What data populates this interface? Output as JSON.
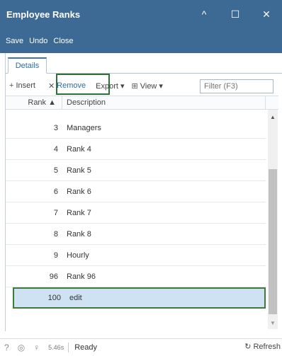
{
  "window": {
    "title": "Employee Ranks",
    "minimize": "^",
    "maximize": "☐",
    "close": "✕"
  },
  "menu": {
    "save": "Save",
    "undo": "Undo",
    "close": "Close"
  },
  "tabs": {
    "details": "Details"
  },
  "toolbar": {
    "insert": "Insert",
    "insert_icon": "+",
    "remove": "Remove",
    "remove_icon": "✕",
    "export": "Export ▾",
    "view": "View ▾",
    "view_icon": "⊞",
    "filter_placeholder": "Filter (F3)"
  },
  "grid": {
    "columns": {
      "rank": "Rank ▲",
      "description": "Description"
    },
    "rows": [
      {
        "rank": "3",
        "description": "Managers"
      },
      {
        "rank": "4",
        "description": "Rank 4"
      },
      {
        "rank": "5",
        "description": "Rank 5"
      },
      {
        "rank": "6",
        "description": "Rank 6"
      },
      {
        "rank": "7",
        "description": "Rank 7"
      },
      {
        "rank": "8",
        "description": "Rank 8"
      },
      {
        "rank": "9",
        "description": "Hourly"
      },
      {
        "rank": "96",
        "description": "Rank 96"
      }
    ],
    "selected_row": {
      "rank": "100",
      "description": "edit"
    }
  },
  "status": {
    "help": "?",
    "time": "5.46s",
    "state": "Ready",
    "refresh": "Refresh"
  }
}
